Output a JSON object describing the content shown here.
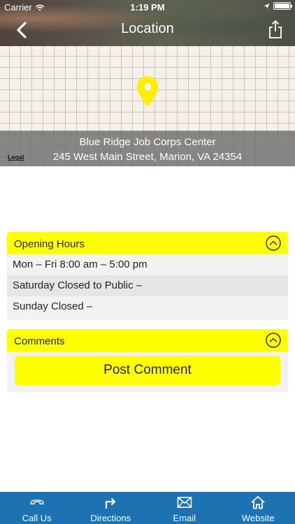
{
  "status_bar": {
    "carrier": "Carrier",
    "time": "1:19 PM"
  },
  "nav": {
    "title": "Location",
    "back_icon": "chevron-left-icon",
    "share_icon": "share-icon"
  },
  "map": {
    "place_name": "Blue Ridge Job Corps Center",
    "address": "245 West Main Street, Marion, VA 24354",
    "legal_label": "Legal",
    "pin_color": "#ffee00"
  },
  "opening_hours": {
    "title": "Opening Hours",
    "rows": [
      "Mon – Fri 8:00 am – 5:00 pm",
      "Saturday Closed to Public –",
      "Sunday Closed –"
    ]
  },
  "comments": {
    "title": "Comments",
    "post_button_label": "Post Comment"
  },
  "tab_bar": {
    "items": [
      {
        "label": "Call Us",
        "icon": "phone-icon"
      },
      {
        "label": "Directions",
        "icon": "directions-icon"
      },
      {
        "label": "Email",
        "icon": "email-icon"
      },
      {
        "label": "Website",
        "icon": "home-icon"
      }
    ]
  },
  "colors": {
    "accent_yellow": "#ffff00",
    "tab_bar_blue": "#1d73b1",
    "panel_gray": "#f2f2f2"
  }
}
